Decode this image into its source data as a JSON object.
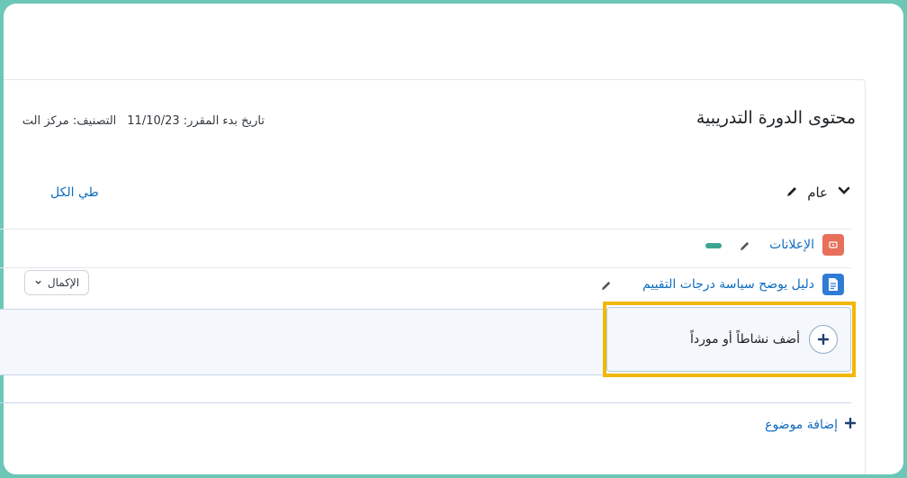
{
  "header": {
    "title": "محتوى الدورة التدريبية",
    "start_date": "تاريخ بدء المقرر: 11/10/23",
    "category": "التصنيف: مركز الت"
  },
  "section": {
    "title": "عام",
    "collapse_all": "طي الكل"
  },
  "activities": [
    {
      "name": "الإعلانات",
      "icon": "announcements-icon",
      "color": "#e8705a"
    },
    {
      "name": "دليل يوضح سياسة درجات التقييم",
      "icon": "document-icon",
      "color": "#2f7bd6"
    }
  ],
  "completion_button": {
    "label": "الإكمال"
  },
  "add_activity": {
    "label": "أضف نشاطاً أو مورداً"
  },
  "add_topic": {
    "label": "إضافة موضوع"
  },
  "colors": {
    "accent": "#0f6cbf",
    "highlight": "#f2b705",
    "frame": "#6cc7b6",
    "badge": "#3aa593"
  }
}
